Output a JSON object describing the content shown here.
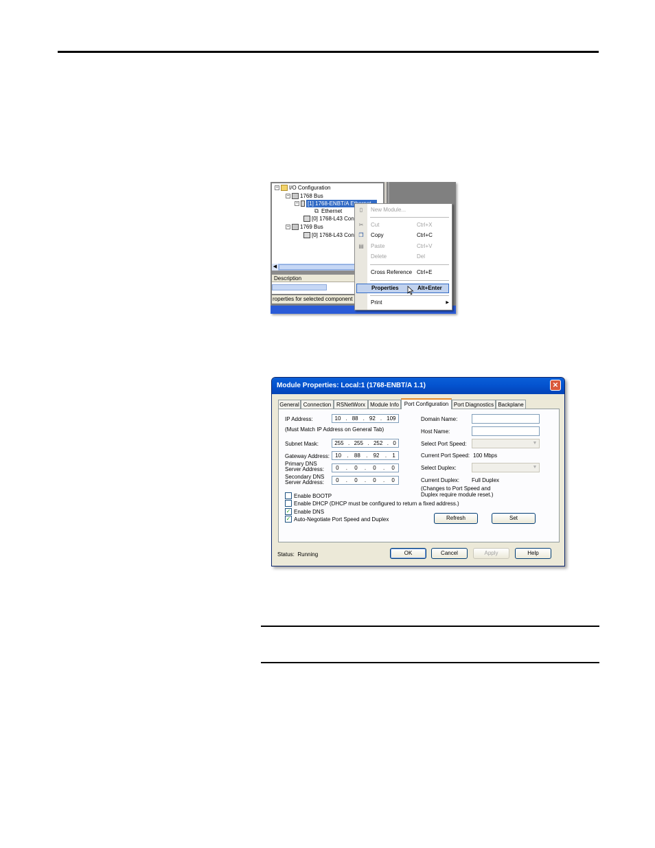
{
  "tree": {
    "items": [
      {
        "label": "I/O Configuration"
      },
      {
        "label": "1768 Bus"
      },
      {
        "label": "[1] 1768-ENBT/A Ethernet..."
      },
      {
        "label": "Ethernet"
      },
      {
        "label": "[0] 1768-L43 Con"
      },
      {
        "label": "1769 Bus"
      },
      {
        "label": "[0] 1768-L43 Con"
      }
    ],
    "description_header": "Description",
    "status": "roperties for selected component"
  },
  "context_menu": {
    "items": [
      {
        "label": "New Module...",
        "shortcut": "",
        "disabled": true
      },
      {
        "label": "Cut",
        "shortcut": "Ctrl+X",
        "disabled": true
      },
      {
        "label": "Copy",
        "shortcut": "Ctrl+C",
        "disabled": false
      },
      {
        "label": "Paste",
        "shortcut": "Ctrl+V",
        "disabled": true
      },
      {
        "label": "Delete",
        "shortcut": "Del",
        "disabled": true
      },
      {
        "label": "Cross Reference",
        "shortcut": "Ctrl+E",
        "disabled": false
      },
      {
        "label": "Properties",
        "shortcut": "Alt+Enter",
        "disabled": false,
        "highlighted": true
      },
      {
        "label": "Print",
        "shortcut": "",
        "disabled": false,
        "submenu": true
      }
    ]
  },
  "dialog": {
    "title": "Module Properties: Local:1 (1768-ENBT/A 1.1)",
    "tabs": [
      {
        "label": "General"
      },
      {
        "label": "Connection"
      },
      {
        "label": "RSNetWorx"
      },
      {
        "label": "Module Info"
      },
      {
        "label": "Port Configuration",
        "active": true
      },
      {
        "label": "Port Diagnostics"
      },
      {
        "label": "Backplane"
      }
    ],
    "ip_address_label": "IP Address:",
    "ip_address": [
      "10",
      "88",
      "92",
      "109"
    ],
    "ip_note": "(Must Match IP Address on General Tab)",
    "subnet_mask_label": "Subnet Mask:",
    "subnet_mask": [
      "255",
      "255",
      "252",
      "0"
    ],
    "gateway_label": "Gateway Address:",
    "gateway": [
      "10",
      "88",
      "92",
      "1"
    ],
    "primary_dns_label_1": "Primary DNS",
    "primary_dns_label_2": "Server Address:",
    "primary_dns": [
      "0",
      "0",
      "0",
      "0"
    ],
    "secondary_dns_label_1": "Secondary DNS",
    "secondary_dns_label_2": "Server Address:",
    "secondary_dns": [
      "0",
      "0",
      "0",
      "0"
    ],
    "enable_bootp": {
      "label": "Enable BOOTP",
      "checked": false
    },
    "enable_dhcp": {
      "label": "Enable DHCP  (DHCP must be configured to return a fixed address.)",
      "checked": false
    },
    "enable_dns": {
      "label": "Enable DNS",
      "checked": true
    },
    "auto_negotiate": {
      "label": "Auto-Negotiate Port Speed and Duplex",
      "checked": true
    },
    "domain_name_label": "Domain Name:",
    "domain_name": "",
    "host_name_label": "Host Name:",
    "host_name": "",
    "select_port_speed_label": "Select Port Speed:",
    "current_port_speed_label": "Current Port Speed:",
    "current_port_speed": "100 Mbps",
    "select_duplex_label": "Select Duplex:",
    "current_duplex_label": "Current Duplex:",
    "current_duplex": "Full Duplex",
    "change_note_1": "(Changes to Port Speed and",
    "change_note_2": "Duplex require module reset.)",
    "refresh_label": "Refresh",
    "set_label": "Set",
    "status_label": "Status:",
    "status_value": "Running",
    "ok_label": "OK",
    "cancel_label": "Cancel",
    "apply_label": "Apply",
    "help_label": "Help"
  }
}
